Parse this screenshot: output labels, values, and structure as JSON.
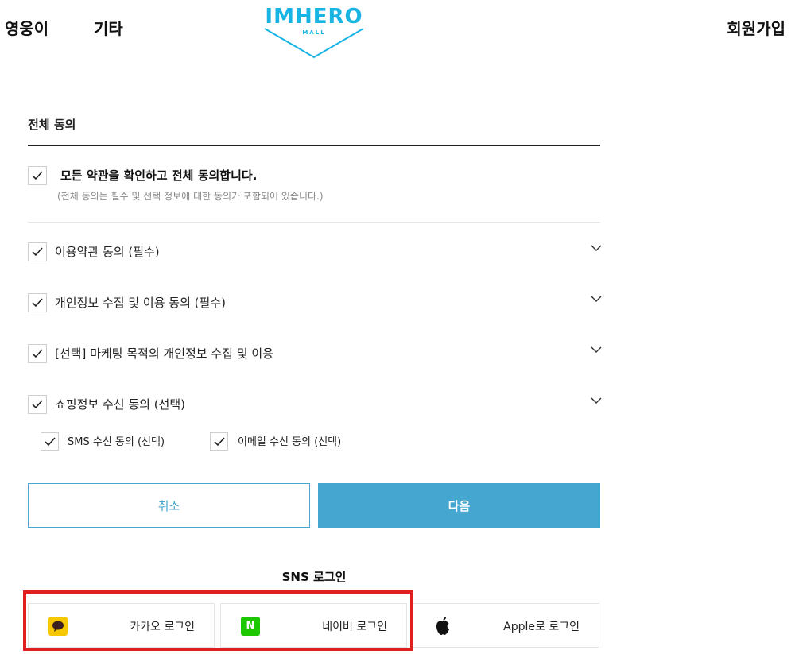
{
  "header": {
    "nav_left": [
      "영웅이",
      "기타"
    ],
    "nav_right": "회원가입",
    "logo_text": "IMHERO",
    "logo_sub": "MALL",
    "brand_color": "#18b4e4"
  },
  "agreement": {
    "section_title": "전체 동의",
    "agree_all_label": "모든 약관을 확인하고 전체 동의합니다.",
    "agree_all_desc": "(전체 동의는 필수 및 선택 정보에 대한 동의가 포함되어 있습니다.)",
    "terms": [
      {
        "label": "이용약관 동의 (필수)",
        "checked": true
      },
      {
        "label": "개인정보 수집 및 이용 동의 (필수)",
        "checked": true
      },
      {
        "label": "[선택] 마케팅 목적의 개인정보 수집 및 이용",
        "checked": true
      },
      {
        "label": "쇼핑정보 수신 동의 (선택)",
        "checked": true
      }
    ],
    "sub_options": [
      {
        "label": "SMS 수신 동의 (선택)",
        "checked": true
      },
      {
        "label": "이메일 수신 동의 (선택)",
        "checked": true
      }
    ]
  },
  "buttons": {
    "cancel": "취소",
    "next": "다음",
    "accent_color": "#45a6cf"
  },
  "sns": {
    "title": "SNS 로그인",
    "kakao": "카카오 로그인",
    "naver": "네이버 로그인",
    "apple": "Apple로 로그인",
    "naver_icon_text": "N",
    "highlight_color": "#e02020"
  }
}
